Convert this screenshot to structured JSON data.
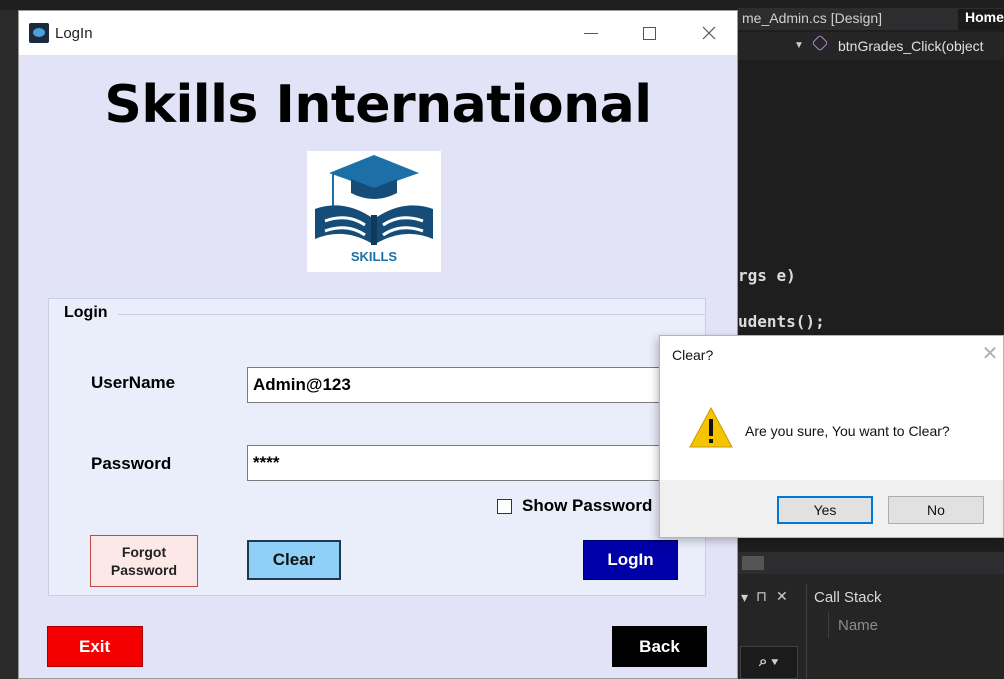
{
  "ide": {
    "tab_text": "me_Admin.cs [Design]",
    "home_tab": "Home",
    "member_dropdown": "btnGrades_Click(object",
    "code_lines": [
      "rgs e)",
      "udents();"
    ],
    "panel_controls": [
      "▾",
      "⊓",
      "✕"
    ],
    "call_stack_title": "Call Stack",
    "call_stack_column": "Name",
    "search_glyph": "⌕ ▾"
  },
  "login_window": {
    "title": "LogIn",
    "heading": "Skills International",
    "logo_text": "SKILLS",
    "group_title": "Login",
    "username_label": "UserName",
    "username_value": "Admin@123",
    "password_label": "Password",
    "password_value": "****",
    "show_password_label": "Show Password",
    "show_password_checked": false,
    "buttons": {
      "forgot_line1": "Forgot",
      "forgot_line2": "Password",
      "clear": "Clear",
      "login": "LogIn",
      "exit": "Exit",
      "back": "Back"
    },
    "colors": {
      "window_bg": "#e3e3f8",
      "clear_bg": "#8ed0f8",
      "login_bg": "#0000a8",
      "exit_bg": "#f40000",
      "back_bg": "#000000",
      "forgot_bg": "#fde8e8"
    }
  },
  "message_box": {
    "title": "Clear?",
    "message": "Are you sure, You want to Clear?",
    "icon": "warning-icon",
    "yes_label": "Yes",
    "no_label": "No",
    "close_glyph": "✕"
  }
}
